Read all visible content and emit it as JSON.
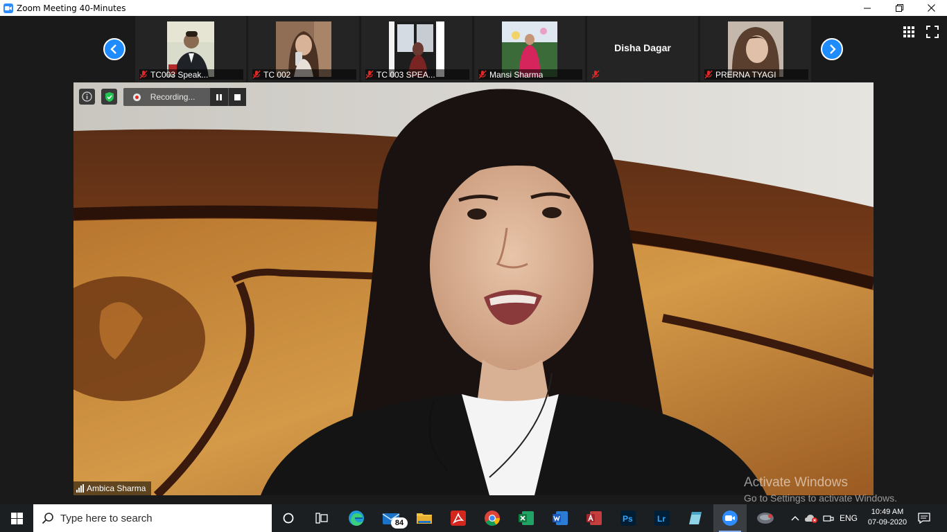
{
  "window": {
    "title": "Zoom Meeting 40-Minutes",
    "controls": [
      "minimize-icon",
      "restore-icon",
      "close-icon"
    ]
  },
  "gallery": {
    "participants": [
      {
        "name": "TC003 Speak...",
        "muted": true,
        "has_video": true
      },
      {
        "name": "TC 002",
        "muted": true,
        "has_video": true
      },
      {
        "name": "TC 003 SPEA...",
        "muted": true,
        "has_video": true
      },
      {
        "name": "Mansi Sharma",
        "muted": true,
        "has_video": true
      },
      {
        "name": "",
        "display_name": "Disha Dagar",
        "muted": true,
        "has_video": false
      },
      {
        "name": "PRERNA TYAGI",
        "muted": true,
        "has_video": true
      }
    ],
    "prev_icon": "chevron-left-icon",
    "next_icon": "chevron-right-icon",
    "view_icons": [
      "grid-view-icon",
      "fullscreen-icon"
    ]
  },
  "main_video": {
    "speaker_name": "Ambica Sharma",
    "recording_label": "Recording...",
    "recording_controls": [
      "pause-icon",
      "stop-icon"
    ]
  },
  "watermark": {
    "line1": "Activate Windows",
    "line2": "Go to Settings to activate Windows."
  },
  "taskbar": {
    "search_placeholder": "Type here to search",
    "apps": [
      "cortana",
      "task-view",
      "edge",
      "mail",
      "file-explorer",
      "acrobat",
      "chrome",
      "excel",
      "word",
      "access",
      "photoshop",
      "lightroom",
      "notepad",
      "zoom",
      "other"
    ],
    "mail_badge": "84",
    "language": "ENG",
    "time": "10:49 AM",
    "date": "07-09-2020"
  }
}
